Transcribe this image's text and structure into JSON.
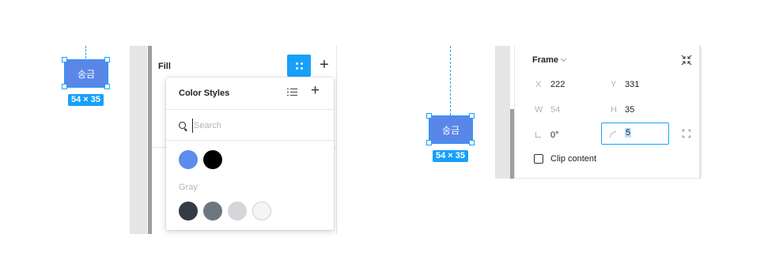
{
  "left_frame": {
    "label": "송금",
    "size_badge": "54 × 35"
  },
  "right_frame": {
    "label": "송금",
    "size_badge": "54 × 35"
  },
  "fill_panel": {
    "title": "Fill",
    "styles_button_icon": "four-dots-icon",
    "add_icon": "plus-icon"
  },
  "color_styles": {
    "title": "Color Styles",
    "list_icon": "list-view-icon",
    "add_icon": "plus-icon",
    "search": {
      "placeholder": "Search",
      "value": ""
    },
    "top_swatches": [
      "#5b8def",
      "#000000"
    ],
    "group": {
      "name": "Gray",
      "swatches": [
        "#343a46",
        "#6e7680",
        "#d4d6da",
        "#f4f5f7"
      ]
    }
  },
  "frame_panel": {
    "title": "Frame",
    "x_label": "X",
    "x_value": "222",
    "y_label": "Y",
    "y_value": "331",
    "w_label": "W",
    "w_value": "54",
    "h_label": "H",
    "h_value": "35",
    "rotation_value": "0°",
    "radius_value": "5",
    "clip_label": "Clip content",
    "clip_checked": false
  },
  "colors": {
    "accent": "#18a0fb",
    "frame_fill": "#5a86e8",
    "divider": "#e5e5e5"
  }
}
